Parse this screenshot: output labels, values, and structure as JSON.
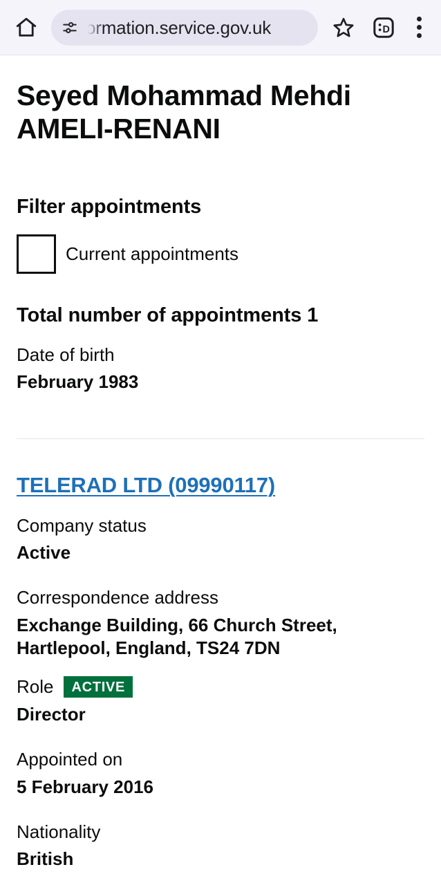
{
  "browser": {
    "home_icon": "home-icon",
    "url_value": "ormation.service.gov.uk",
    "url_placeholder": "Search or type URL",
    "page_info_icon": "tune-icon",
    "bookmark_icon": "star-icon",
    "tab_switcher_label": ":D",
    "menu_icon": "more-vertical-icon"
  },
  "person": {
    "name": "Seyed Mohammad Mehdi AMELI-RENANI",
    "date_of_birth_label": "Date of birth",
    "date_of_birth_value": "February 1983"
  },
  "filter": {
    "heading": "Filter appointments",
    "checkbox_label": "Current appointments",
    "checkbox_checked": false
  },
  "totals": {
    "heading": "Total number of appointments 1",
    "count": "1"
  },
  "appointment": {
    "company_link": "TELERAD LTD (09990117)",
    "company_name": "TELERAD LTD",
    "company_number": "09990117",
    "company_status_label": "Company status",
    "company_status_value": "Active",
    "address_label": "Correspondence address",
    "address_value": "Exchange Building, 66 Church Street, Hartlepool, England, TS24 7DN",
    "role_label": "Role",
    "role_badge": "ACTIVE",
    "role_value": "Director",
    "appointed_label": "Appointed on",
    "appointed_value": "5 February 2016",
    "nationality_label": "Nationality",
    "nationality_value": "British"
  },
  "colors": {
    "link_blue": "#1D70B8",
    "badge_green": "#00703C",
    "text_black": "#0B0C0C",
    "toolbar_bg": "#F6F4FB",
    "url_pill_bg": "#E6E3F1"
  }
}
